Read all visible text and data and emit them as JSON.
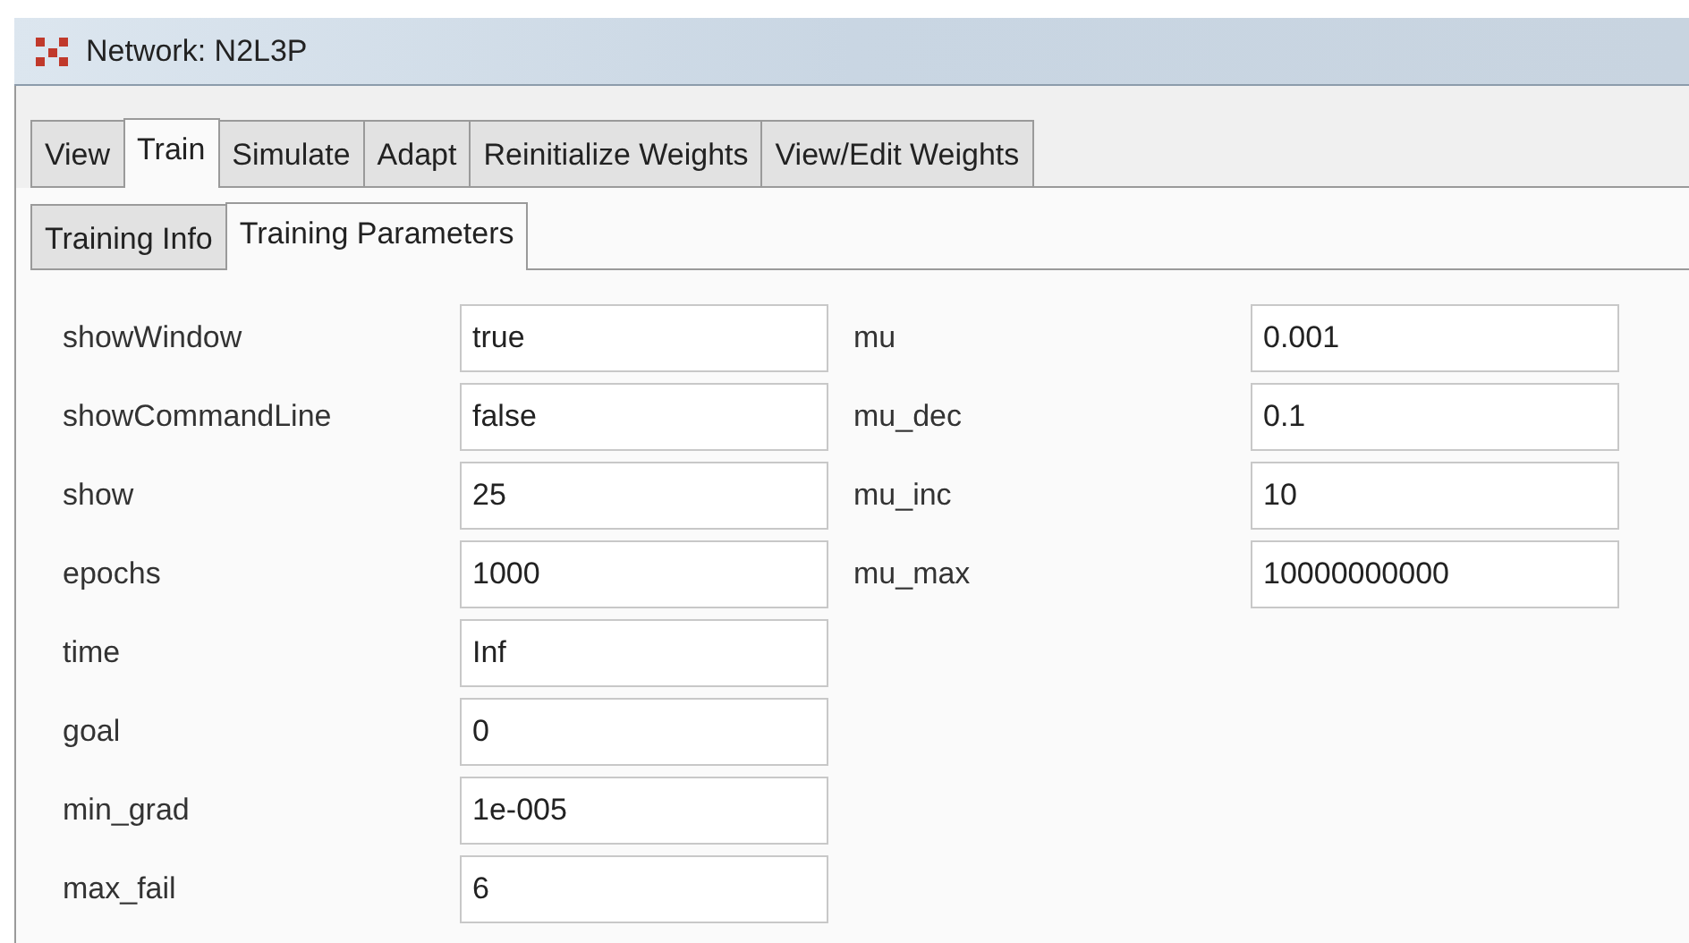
{
  "window": {
    "title": "Network: N2L3P"
  },
  "tabs": [
    {
      "label": "View",
      "selected": false
    },
    {
      "label": "Train",
      "selected": true
    },
    {
      "label": "Simulate",
      "selected": false
    },
    {
      "label": "Adapt",
      "selected": false
    },
    {
      "label": "Reinitialize Weights",
      "selected": false
    },
    {
      "label": "View/Edit Weights",
      "selected": false
    }
  ],
  "subtabs": [
    {
      "label": "Training Info",
      "selected": false
    },
    {
      "label": "Training Parameters",
      "selected": true
    }
  ],
  "parameters_left": [
    {
      "name": "showWindow",
      "value": "true"
    },
    {
      "name": "showCommandLine",
      "value": "false"
    },
    {
      "name": "show",
      "value": "25"
    },
    {
      "name": "epochs",
      "value": "1000"
    },
    {
      "name": "time",
      "value": "Inf"
    },
    {
      "name": "goal",
      "value": "0"
    },
    {
      "name": "min_grad",
      "value": "1e-005"
    },
    {
      "name": "max_fail",
      "value": "6"
    }
  ],
  "parameters_right": [
    {
      "name": "mu",
      "value": "0.001"
    },
    {
      "name": "mu_dec",
      "value": "0.1"
    },
    {
      "name": "mu_inc",
      "value": "10"
    },
    {
      "name": "mu_max",
      "value": "10000000000"
    }
  ]
}
